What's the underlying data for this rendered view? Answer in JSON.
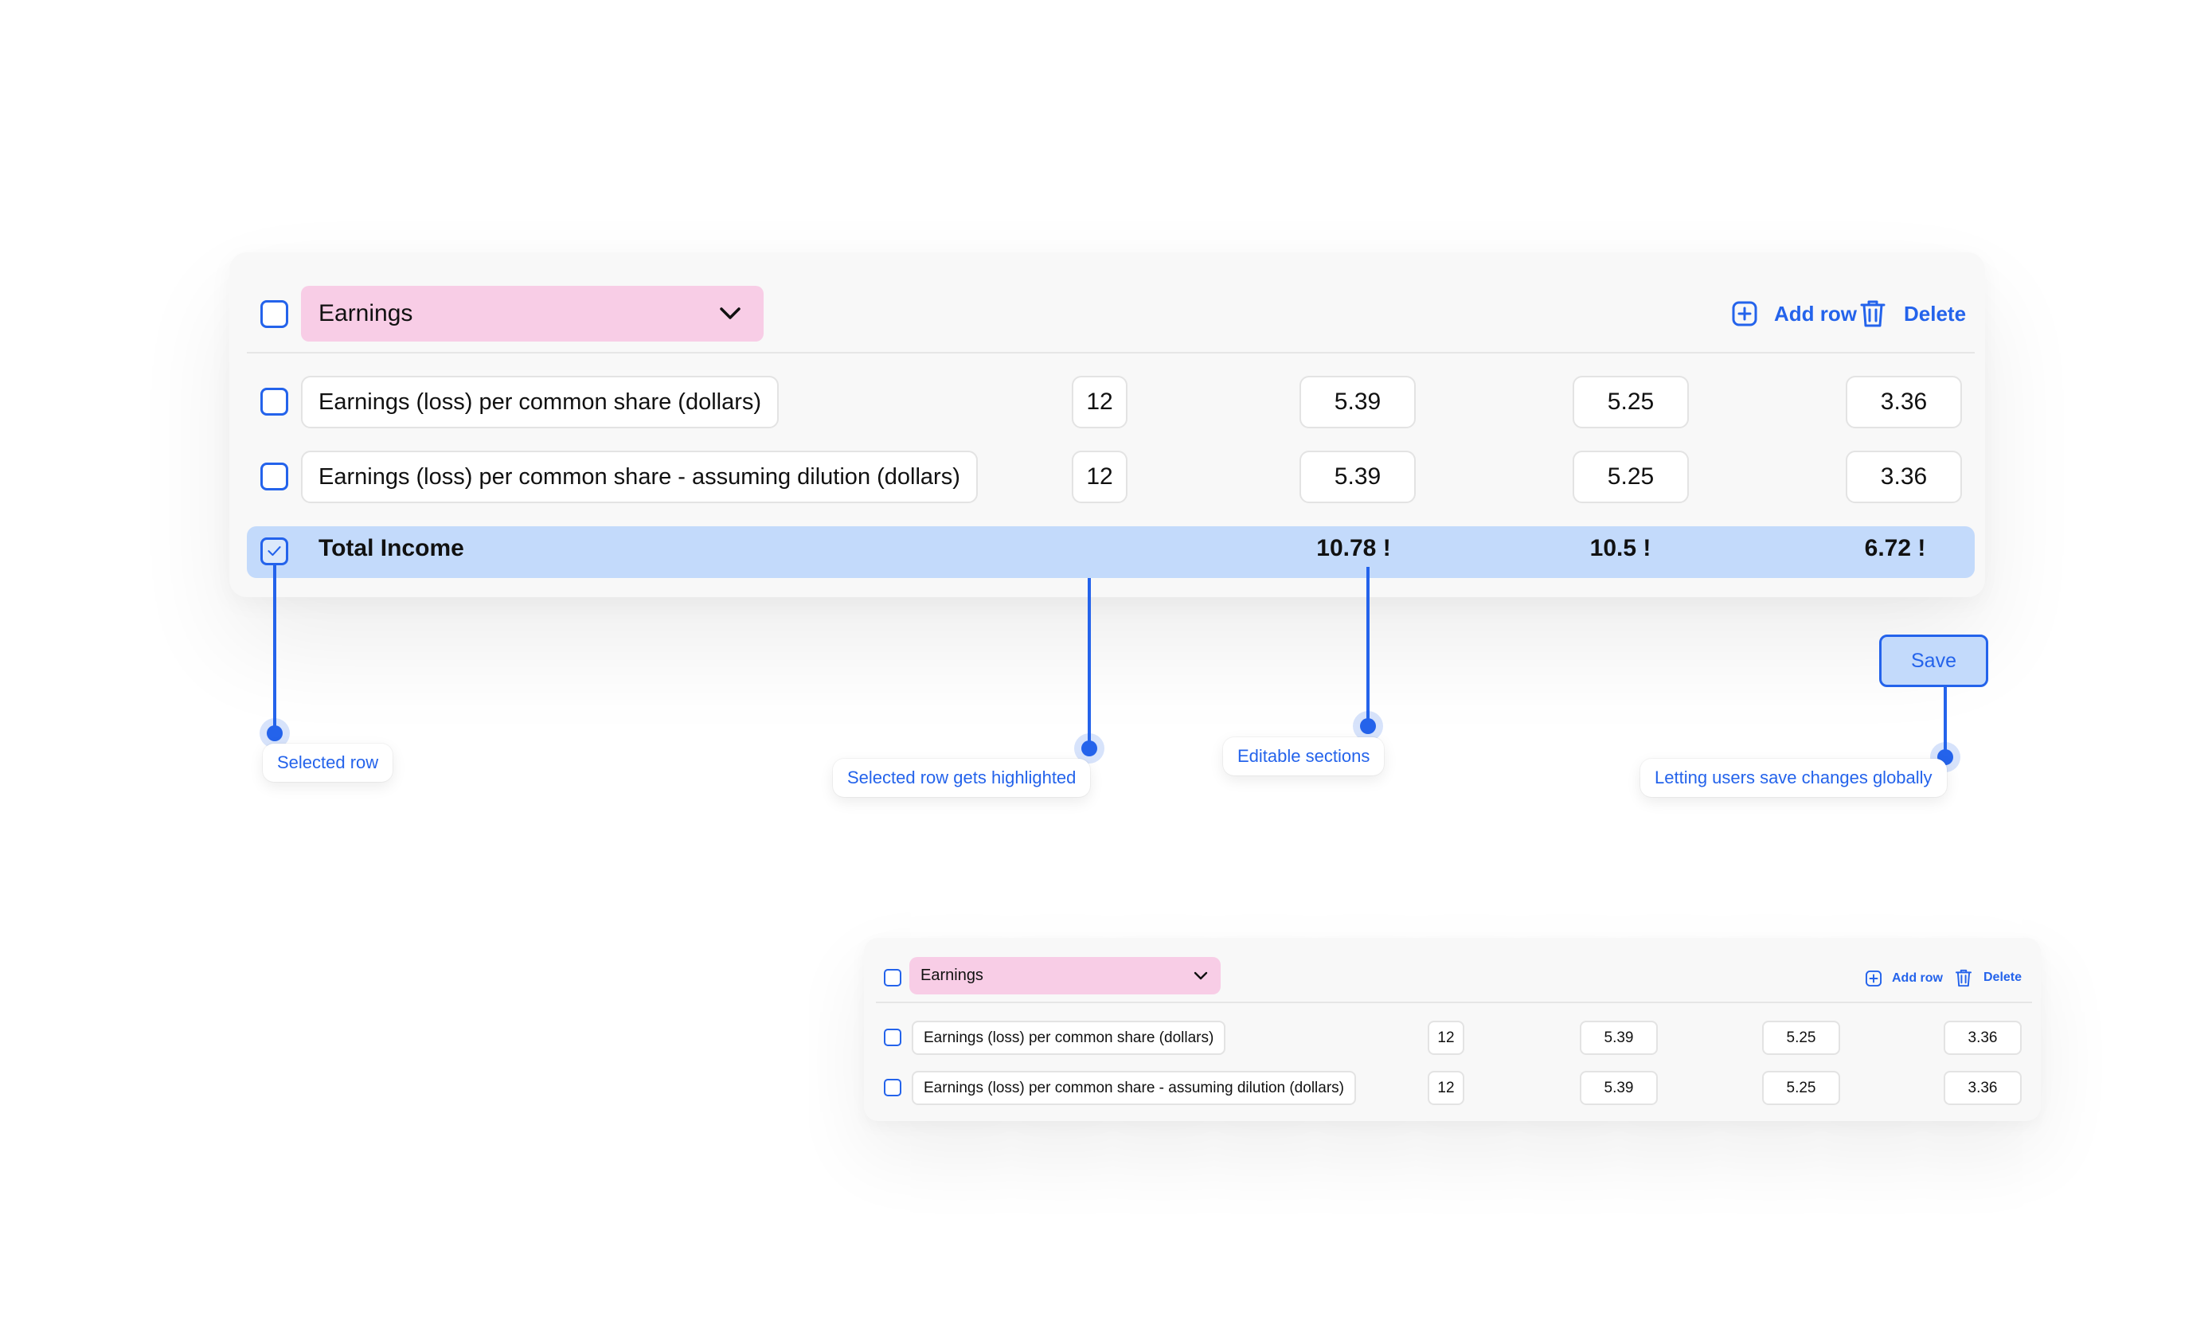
{
  "main_table": {
    "category": {
      "label": "Earnings",
      "icon": "chevron-down-icon"
    },
    "toolbar": {
      "add_row_label": "Add row",
      "delete_label": "Delete"
    },
    "rows": [
      {
        "label": "Earnings (loss) per common share (dollars)",
        "values": [
          "12",
          "5.39",
          "5.25",
          "3.36"
        ]
      },
      {
        "label": "Earnings (loss) per common share - assuming dilution (dollars)",
        "values": [
          "12",
          "5.39",
          "5.25",
          "3.36"
        ]
      }
    ],
    "total": {
      "label": "Total Income",
      "values": [
        "10.78 !",
        "10.5 !",
        "6.72 !"
      ]
    },
    "save_label": "Save"
  },
  "callouts": {
    "selected_row": "Selected row",
    "highlighted": "Selected row gets highlighted",
    "editable": "Editable sections",
    "save_globally": "Letting users save changes globally"
  },
  "mini_table": {
    "category": {
      "label": "Earnings",
      "icon": "chevron-down-icon"
    },
    "toolbar": {
      "add_row_label": "Add row",
      "delete_label": "Delete"
    },
    "rows": [
      {
        "label": "Earnings (loss) per common share (dollars)",
        "values": [
          "12",
          "5.39",
          "5.25",
          "3.36"
        ]
      },
      {
        "label": "Earnings (loss) per common share - assuming dilution (dollars)",
        "values": [
          "12",
          "5.39",
          "5.25",
          "3.36"
        ]
      }
    ]
  },
  "colors": {
    "accent": "#2463eb",
    "category_bg": "#f8cde6",
    "highlight_row": "#c3dafb",
    "card_bg": "#f8f8f8"
  }
}
